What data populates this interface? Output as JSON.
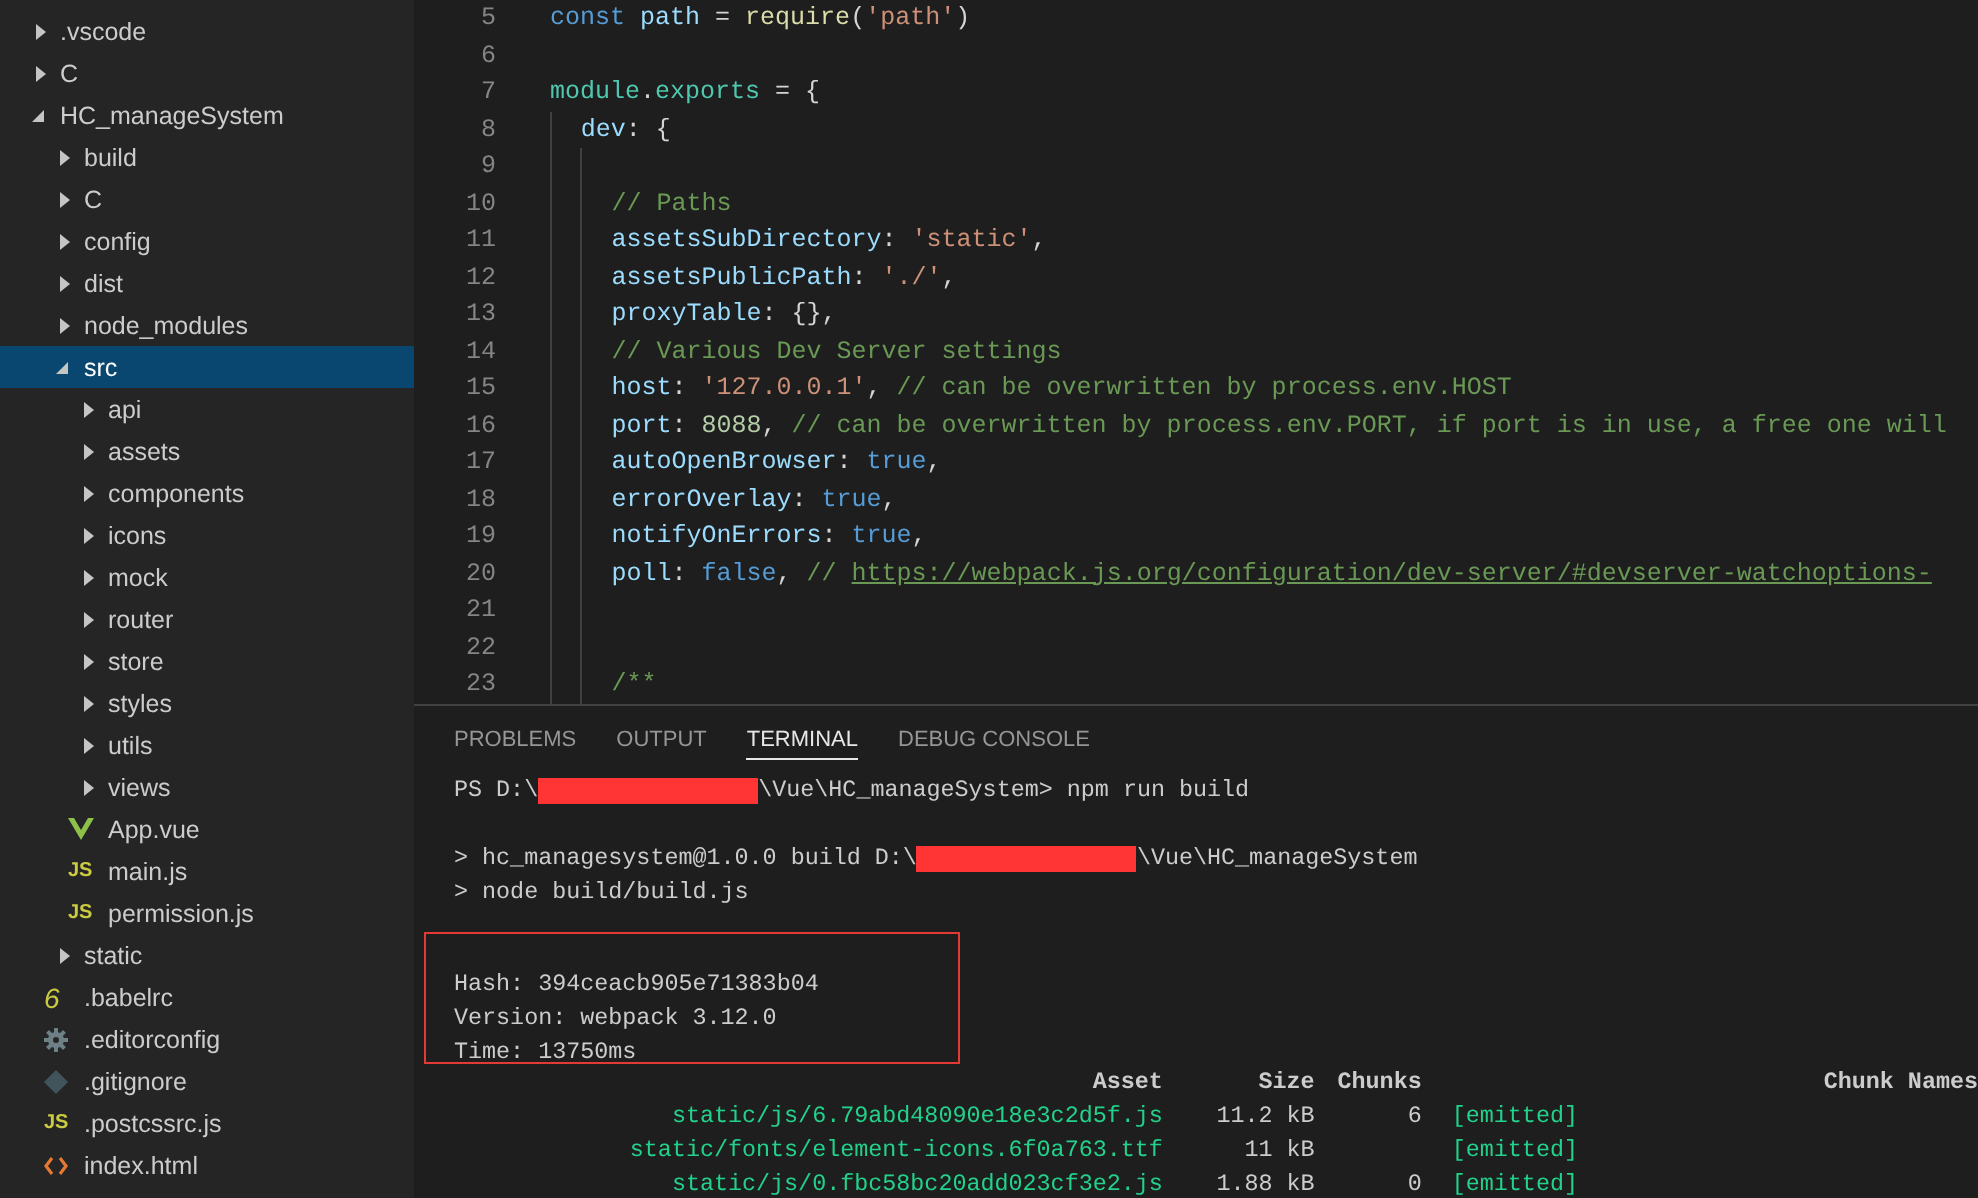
{
  "explorer": {
    "items": [
      {
        "name": ".vscode",
        "kind": "folder",
        "expanded": false,
        "selected": false
      },
      {
        "name": "C",
        "kind": "folder",
        "expanded": false,
        "selected": false
      },
      {
        "name": "HC_manageSystem",
        "kind": "folder",
        "expanded": true,
        "selected": false,
        "children": [
          {
            "name": "build",
            "kind": "folder",
            "expanded": false,
            "selected": false
          },
          {
            "name": "C",
            "kind": "folder",
            "expanded": false,
            "selected": false
          },
          {
            "name": "config",
            "kind": "folder",
            "expanded": false,
            "selected": false
          },
          {
            "name": "dist",
            "kind": "folder",
            "expanded": false,
            "selected": false
          },
          {
            "name": "node_modules",
            "kind": "folder",
            "expanded": false,
            "selected": false
          },
          {
            "name": "src",
            "kind": "folder",
            "expanded": true,
            "selected": true,
            "children": [
              {
                "name": "api",
                "kind": "folder",
                "expanded": false,
                "selected": false
              },
              {
                "name": "assets",
                "kind": "folder",
                "expanded": false,
                "selected": false
              },
              {
                "name": "components",
                "kind": "folder",
                "expanded": false,
                "selected": false
              },
              {
                "name": "icons",
                "kind": "folder",
                "expanded": false,
                "selected": false
              },
              {
                "name": "mock",
                "kind": "folder",
                "expanded": false,
                "selected": false
              },
              {
                "name": "router",
                "kind": "folder",
                "expanded": false,
                "selected": false
              },
              {
                "name": "store",
                "kind": "folder",
                "expanded": false,
                "selected": false
              },
              {
                "name": "styles",
                "kind": "folder",
                "expanded": false,
                "selected": false
              },
              {
                "name": "utils",
                "kind": "folder",
                "expanded": false,
                "selected": false
              },
              {
                "name": "views",
                "kind": "folder",
                "expanded": false,
                "selected": false
              },
              {
                "name": "App.vue",
                "kind": "vue",
                "selected": false
              },
              {
                "name": "main.js",
                "kind": "js",
                "badge": "JS",
                "selected": false
              },
              {
                "name": "permission.js",
                "kind": "js",
                "badge": "JS",
                "selected": false
              }
            ]
          },
          {
            "name": "static",
            "kind": "folder",
            "expanded": false,
            "selected": false
          },
          {
            "name": ".babelrc",
            "kind": "babel",
            "badge": "6",
            "selected": false
          },
          {
            "name": ".editorconfig",
            "kind": "config",
            "selected": false
          },
          {
            "name": ".gitignore",
            "kind": "git",
            "selected": false
          },
          {
            "name": ".postcssrc.js",
            "kind": "js",
            "badge": "JS",
            "selected": false
          },
          {
            "name": "index.html",
            "kind": "html",
            "selected": false
          }
        ]
      }
    ]
  },
  "editor": {
    "lines": [
      {
        "n": "5",
        "tokens": [
          {
            "t": "const ",
            "kind": "keyword"
          },
          {
            "t": "path",
            "kind": "var"
          },
          {
            "t": " = ",
            "kind": "plain"
          },
          {
            "t": "require",
            "kind": "function"
          },
          {
            "t": "(",
            "kind": "plain"
          },
          {
            "t": "'path'",
            "kind": "string"
          },
          {
            "t": ")",
            "kind": "plain"
          }
        ]
      },
      {
        "n": "6"
      },
      {
        "n": "7",
        "tokens": [
          {
            "t": "module",
            "kind": "type"
          },
          {
            "t": ".",
            "kind": "plain"
          },
          {
            "t": "exports",
            "kind": "type"
          },
          {
            "t": " = {",
            "kind": "plain"
          }
        ],
        "children": [
          {
            "n": "8",
            "tokens": [
              {
                "t": "dev",
                "kind": "var"
              },
              {
                "t": ": {",
                "kind": "plain"
              }
            ],
            "children": [
              {
                "n": "9"
              },
              {
                "n": "10",
                "tokens": [
                  {
                    "t": "// Paths",
                    "kind": "comment"
                  }
                ]
              },
              {
                "n": "11",
                "tokens": [
                  {
                    "t": "assetsSubDirectory",
                    "kind": "var"
                  },
                  {
                    "t": ": ",
                    "kind": "plain"
                  },
                  {
                    "t": "'static'",
                    "kind": "string"
                  },
                  {
                    "t": ",",
                    "kind": "plain"
                  }
                ]
              },
              {
                "n": "12",
                "tokens": [
                  {
                    "t": "assetsPublicPath",
                    "kind": "var"
                  },
                  {
                    "t": ": ",
                    "kind": "plain"
                  },
                  {
                    "t": "'./'",
                    "kind": "string"
                  },
                  {
                    "t": ",",
                    "kind": "plain"
                  }
                ]
              },
              {
                "n": "13",
                "tokens": [
                  {
                    "t": "proxyTable",
                    "kind": "var"
                  },
                  {
                    "t": ": {},",
                    "kind": "plain"
                  }
                ]
              },
              {
                "n": "14",
                "tokens": [
                  {
                    "t": "// Various Dev Server settings",
                    "kind": "comment"
                  }
                ]
              },
              {
                "n": "15",
                "tokens": [
                  {
                    "t": "host",
                    "kind": "var"
                  },
                  {
                    "t": ": ",
                    "kind": "plain"
                  },
                  {
                    "t": "'127.0.0.1'",
                    "kind": "string"
                  },
                  {
                    "t": ", ",
                    "kind": "plain"
                  },
                  {
                    "t": "// can be overwritten by process.env.HOST",
                    "kind": "comment"
                  }
                ]
              },
              {
                "n": "16",
                "tokens": [
                  {
                    "t": "port",
                    "kind": "var"
                  },
                  {
                    "t": ": ",
                    "kind": "plain"
                  },
                  {
                    "t": "8088",
                    "kind": "number"
                  },
                  {
                    "t": ", ",
                    "kind": "plain"
                  },
                  {
                    "t": "// can be overwritten by process.env.PORT, if port is in use, a free one will",
                    "kind": "comment"
                  }
                ]
              },
              {
                "n": "17",
                "tokens": [
                  {
                    "t": "autoOpenBrowser",
                    "kind": "var"
                  },
                  {
                    "t": ": ",
                    "kind": "plain"
                  },
                  {
                    "t": "true",
                    "kind": "keyword"
                  },
                  {
                    "t": ",",
                    "kind": "plain"
                  }
                ]
              },
              {
                "n": "18",
                "tokens": [
                  {
                    "t": "errorOverlay",
                    "kind": "var"
                  },
                  {
                    "t": ": ",
                    "kind": "plain"
                  },
                  {
                    "t": "true",
                    "kind": "keyword"
                  },
                  {
                    "t": ",",
                    "kind": "plain"
                  }
                ]
              },
              {
                "n": "19",
                "tokens": [
                  {
                    "t": "notifyOnErrors",
                    "kind": "var"
                  },
                  {
                    "t": ": ",
                    "kind": "plain"
                  },
                  {
                    "t": "true",
                    "kind": "keyword"
                  },
                  {
                    "t": ",",
                    "kind": "plain"
                  }
                ]
              },
              {
                "n": "20",
                "tokens": [
                  {
                    "t": "poll",
                    "kind": "var"
                  },
                  {
                    "t": ": ",
                    "kind": "plain"
                  },
                  {
                    "t": "false",
                    "kind": "keyword"
                  },
                  {
                    "t": ", ",
                    "kind": "plain"
                  },
                  {
                    "t": "// ",
                    "kind": "comment"
                  },
                  {
                    "t": "https://webpack.js.org/configuration/dev-server/#devserver-watchoptions-",
                    "kind": "link"
                  }
                ]
              },
              {
                "n": "21"
              },
              {
                "n": "22"
              },
              {
                "n": "23",
                "tokens": [
                  {
                    "t": "/**",
                    "kind": "comment"
                  }
                ]
              }
            ]
          }
        ]
      }
    ]
  },
  "panel": {
    "tabs": [
      {
        "label": "PROBLEMS",
        "selected": false
      },
      {
        "label": "OUTPUT",
        "selected": false
      },
      {
        "label": "TERMINAL",
        "selected": true
      },
      {
        "label": "DEBUG CONSOLE",
        "selected": false
      }
    ],
    "terminal": {
      "command_groups": [
        {
          "lines": [
            {
              "segments": [
                {
                  "kind": "text",
                  "t": "PS D:\\"
                },
                {
                  "kind": "redacted"
                },
                {
                  "kind": "text",
                  "t": "\\Vue\\HC_manageSystem> npm run build"
                }
              ]
            }
          ]
        },
        {
          "lines": [
            {
              "segments": [
                {
                  "kind": "text",
                  "t": "> hc_managesystem@1.0.0 build D:\\"
                },
                {
                  "kind": "redacted"
                },
                {
                  "kind": "text",
                  "t": "\\Vue\\HC_manageSystem"
                }
              ]
            },
            {
              "segments": [
                {
                  "kind": "text",
                  "t": "> node build/build.js"
                }
              ]
            }
          ]
        }
      ],
      "highlighted_summary": [
        "Hash: 394ceacb905e71383b04",
        "Version: webpack 3.12.0",
        "Time: 13750ms"
      ],
      "table": {
        "columns": [
          "Asset",
          "Size",
          "Chunks",
          "",
          "Chunk Names"
        ],
        "rows": [
          {
            "asset": "static/js/6.79abd48090e18e3c2d5f.js",
            "size": "11.2 kB",
            "chunks": "6",
            "status": "[emitted]"
          },
          {
            "asset": "static/fonts/element-icons.6f0a763.ttf",
            "size": "11 kB",
            "status": "[emitted]"
          },
          {
            "asset": "static/js/0.fbc58bc20add023cf3e2.js",
            "size": "1.88 kB",
            "chunks": "0",
            "status": "[emitted]"
          }
        ]
      }
    }
  }
}
